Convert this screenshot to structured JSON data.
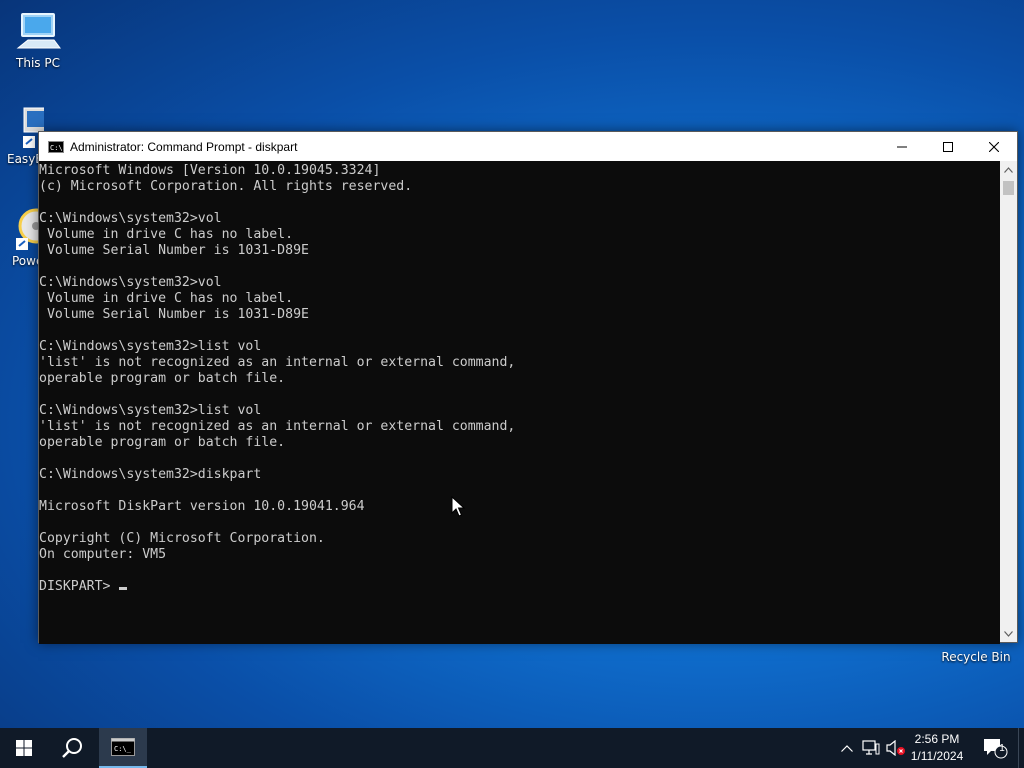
{
  "desktop": {
    "icons": [
      {
        "label": "This PC",
        "icon": "computer-icon"
      },
      {
        "label": "EasyB",
        "icon": "easybcd-icon"
      },
      {
        "label": "Powe",
        "icon": "power-dvd-icon"
      },
      {
        "label": "Recycle Bin",
        "icon": "recycle-bin-icon"
      }
    ]
  },
  "window": {
    "title": "Administrator: Command Prompt - diskpart",
    "icon": "cmd-icon",
    "minimize_icon": "minimize-icon",
    "maximize_icon": "maximize-icon",
    "close_icon": "close-icon"
  },
  "console": {
    "lines": [
      "Microsoft Windows [Version 10.0.19045.3324]",
      "(c) Microsoft Corporation. All rights reserved.",
      "",
      "C:\\Windows\\system32>vol",
      " Volume in drive C has no label.",
      " Volume Serial Number is 1031-D89E",
      "",
      "C:\\Windows\\system32>vol",
      " Volume in drive C has no label.",
      " Volume Serial Number is 1031-D89E",
      "",
      "C:\\Windows\\system32>list vol",
      "'list' is not recognized as an internal or external command,",
      "operable program or batch file.",
      "",
      "C:\\Windows\\system32>list vol",
      "'list' is not recognized as an internal or external command,",
      "operable program or batch file.",
      "",
      "C:\\Windows\\system32>diskpart",
      "",
      "Microsoft DiskPart version 10.0.19041.964",
      "",
      "Copyright (C) Microsoft Corporation.",
      "On computer: VM5",
      ""
    ],
    "prompt": "DISKPART> "
  },
  "taskbar": {
    "start_icon": "windows-start-icon",
    "search_icon": "search-icon",
    "app_icon": "cmd-icon",
    "tray_icons": [
      "chevron-up-icon",
      "network-icon",
      "volume-muted-icon"
    ],
    "time": "2:56 PM",
    "date": "1/11/2024",
    "notification_count": "1",
    "notification_icon": "notification-icon"
  }
}
